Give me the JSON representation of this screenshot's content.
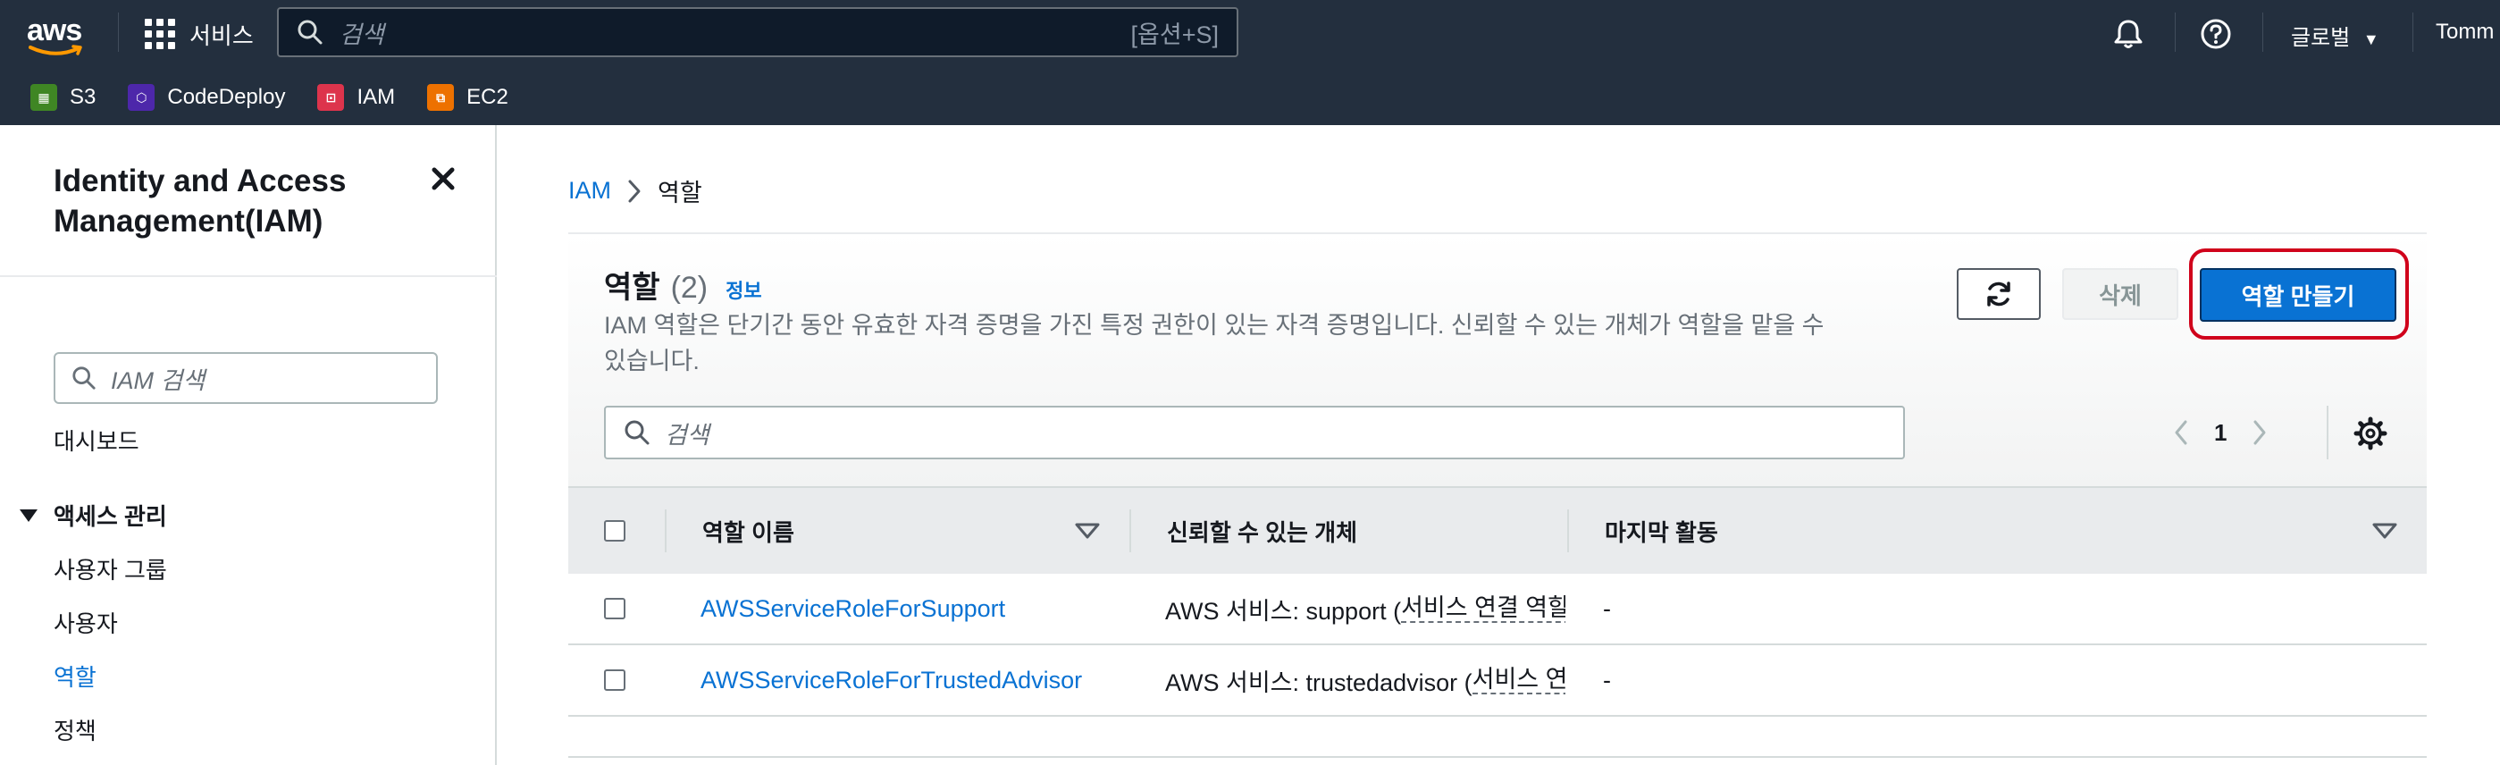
{
  "topnav": {
    "logo_text": "aws",
    "services_label": "서비스",
    "search_placeholder": "검색",
    "search_shortcut": "[옵션+S]",
    "region_label": "글로벌",
    "user_label": "Tomm",
    "favorites": [
      {
        "label": "S3",
        "color": "#3f8624"
      },
      {
        "label": "CodeDeploy",
        "color": "#4d27aa"
      },
      {
        "label": "IAM",
        "color": "#dd344c"
      },
      {
        "label": "EC2",
        "color": "#ed7100"
      }
    ]
  },
  "sidebar": {
    "title": "Identity and Access Management(IAM)",
    "search_placeholder": "IAM 검색",
    "dashboard": "대시보드",
    "section_access": "액세스 관리",
    "items": [
      "사용자 그룹",
      "사용자",
      "역할",
      "정책"
    ],
    "active_item": "역할"
  },
  "breadcrumb": {
    "root": "IAM",
    "current": "역할"
  },
  "panel": {
    "title": "역할",
    "count": "(2)",
    "info_link": "정보",
    "description": "IAM 역할은 단기간 동안 유효한 자격 증명을 가진 특정 권한이 있는 자격 증명입니다. 신뢰할 수 있는 개체가 역할을 맡을 수 있습니다.",
    "delete_label": "삭제",
    "create_label": "역할 만들기",
    "search_placeholder": "검색",
    "page_number": "1"
  },
  "table": {
    "columns": [
      "역할 이름",
      "신뢰할 수 있는 개체",
      "마지막 활동"
    ],
    "rows": [
      {
        "name": "AWSServiceRoleForSupport",
        "trusted_prefix": "AWS 서비스: support (",
        "trusted_link": "서비스 연결 역할",
        "last_activity": "-"
      },
      {
        "name": "AWSServiceRoleForTrustedAdvisor",
        "trusted_prefix": "AWS 서비스: trustedadvisor (",
        "trusted_link": "서비스 연결 역할",
        "last_activity": "-"
      }
    ]
  },
  "colors": {
    "nav_bg": "#232f3e",
    "link": "#0972d3",
    "primary_button": "#0972d3",
    "highlight_ring": "#d0021b"
  }
}
